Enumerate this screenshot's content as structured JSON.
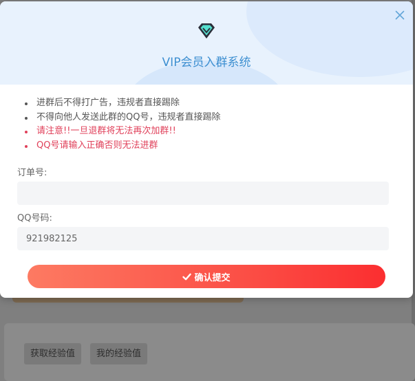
{
  "modal": {
    "title": "VIP会员入群系统",
    "close_icon": "close-icon",
    "header_icon": "diamond-icon",
    "rules": [
      {
        "text": "进群后不得打广告，违规者直接踢除",
        "warning": false
      },
      {
        "text": "不得向他人发送此群的QQ号，违规者直接踢除",
        "warning": false
      },
      {
        "text": "请注意!!一旦退群将无法再次加群!!",
        "warning": true
      },
      {
        "text": "QQ号请输入正确否则无法进群",
        "warning": true
      }
    ],
    "order_field": {
      "label": "订单号:",
      "value": "",
      "placeholder": ""
    },
    "qq_field": {
      "label": "QQ号码:",
      "value": "921982125",
      "placeholder": ""
    },
    "submit": {
      "label": "确认提交",
      "icon": "check-icon"
    }
  },
  "background": {
    "buttons": [
      "获取经验值",
      "我的经验值"
    ]
  },
  "colors": {
    "title": "#3d8fd1",
    "warning": "#e0405a",
    "submit_start": "#fd7a62",
    "submit_end": "#fb2e30"
  }
}
